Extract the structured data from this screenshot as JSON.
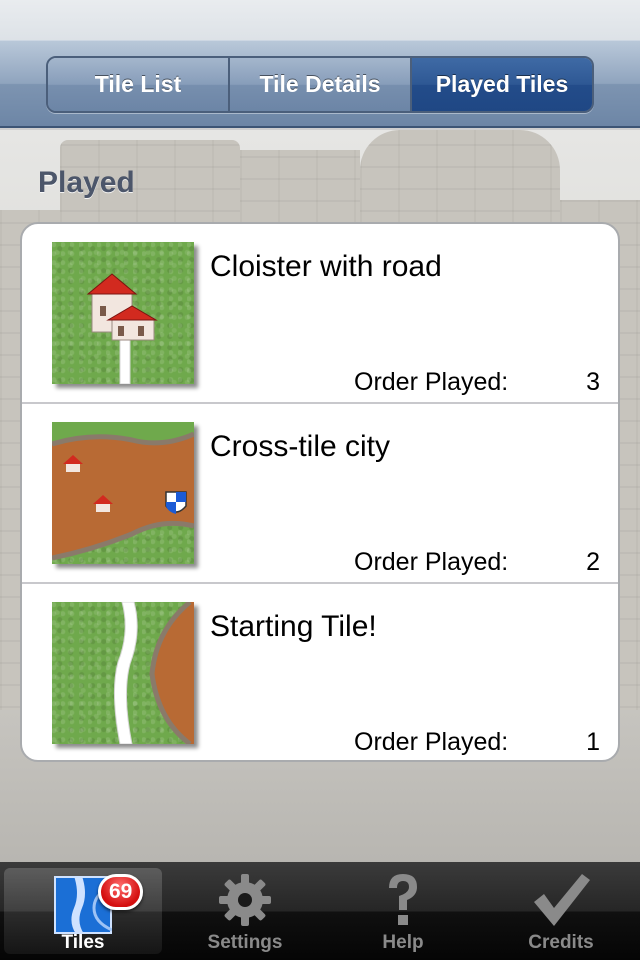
{
  "segmented": {
    "tabs": [
      {
        "label": "Tile List",
        "active": false
      },
      {
        "label": "Tile Details",
        "active": false
      },
      {
        "label": "Played Tiles",
        "active": true
      }
    ]
  },
  "section": {
    "title": "Played"
  },
  "rows": [
    {
      "title": "Cloister with road",
      "order_label": "Order Played:",
      "order_value": "3",
      "tile_icon": "cloister-road-tile-icon"
    },
    {
      "title": "Cross-tile city",
      "order_label": "Order Played:",
      "order_value": "2",
      "tile_icon": "city-tile-icon"
    },
    {
      "title": "Starting Tile!",
      "order_label": "Order Played:",
      "order_value": "1",
      "tile_icon": "starting-tile-icon"
    }
  ],
  "tabbar": {
    "tabs": [
      {
        "label": "Tiles",
        "icon": "tiles-icon",
        "badge": "69",
        "active": true
      },
      {
        "label": "Settings",
        "icon": "gear-icon",
        "active": false
      },
      {
        "label": "Help",
        "icon": "question-icon",
        "active": false
      },
      {
        "label": "Credits",
        "icon": "checkmark-icon",
        "active": false
      }
    ]
  },
  "colors": {
    "accent": "#1f4784",
    "grass": "#6fa94c",
    "dirt": "#b86a34",
    "roof": "#d22a1f",
    "badge": "#d40f0f"
  }
}
